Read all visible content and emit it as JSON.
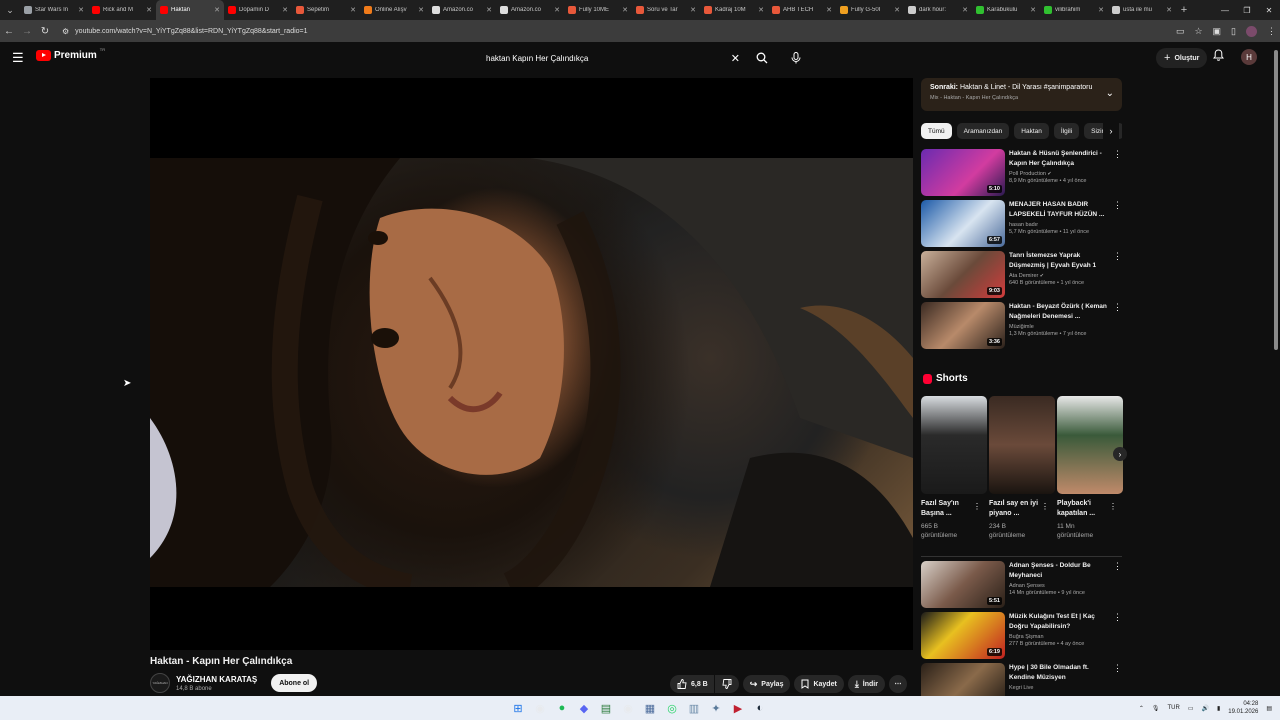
{
  "browser": {
    "tabs": [
      {
        "title": "Star Wars İn",
        "color": "#9aa0a6",
        "active": false
      },
      {
        "title": "Rick and M",
        "color": "#ff0000",
        "active": false
      },
      {
        "title": "Haktan",
        "color": "#ff0000",
        "active": true
      },
      {
        "title": "Dopamin D",
        "color": "#ff0000",
        "active": false
      },
      {
        "title": "Sepetim",
        "color": "#e8583a",
        "active": false
      },
      {
        "title": "Online Alışv",
        "color": "#f07b1a",
        "active": false
      },
      {
        "title": "Amazon.co",
        "color": "#dddddd",
        "active": false
      },
      {
        "title": "Amazon.co",
        "color": "#dddddd",
        "active": false
      },
      {
        "title": "Fully 10ME",
        "color": "#e8583a",
        "active": false
      },
      {
        "title": "Soru ve Tar",
        "color": "#e8583a",
        "active": false
      },
      {
        "title": "Kadraj 10M",
        "color": "#e8583a",
        "active": false
      },
      {
        "title": "AHB TECH",
        "color": "#e8583a",
        "active": false
      },
      {
        "title": "Fully G-50I",
        "color": "#f0a020",
        "active": false
      },
      {
        "title": "dark hour:",
        "color": "#cccccc",
        "active": false
      },
      {
        "title": "Karabukulu",
        "color": "#30c030",
        "active": false
      },
      {
        "title": "vilibrahim",
        "color": "#30c030",
        "active": false
      },
      {
        "title": "usta ile mu",
        "color": "#cccccc",
        "active": false
      }
    ],
    "url": "youtube.com/watch?v=N_YiYTgZq88&list=RDN_YiYTgZq88&start_radio=1"
  },
  "header": {
    "logo_text": "Premium",
    "region": "TR",
    "search_query": "haktan Kapın Her Çalındıkça",
    "create_label": "Oluştur",
    "avatar_letter": "H"
  },
  "video": {
    "title": "Haktan - Kapın Her Çalındıkça",
    "channel": "YAĞIZHAN KARATAŞ",
    "channel_avatar_text": "YAĞIZHAN",
    "subscribers": "14,8 B abone",
    "subscribe_label": "Abone ol",
    "likes": "6,8 B",
    "share_label": "Paylaş",
    "save_label": "Kaydet",
    "download_label": "İndir"
  },
  "up_next": {
    "label": "Sonraki:",
    "title": "Haktan & Linet - Dil Yarası #şanimparatoru",
    "subtitle": "Mix - Haktan - Kapın Her Çalındıkça"
  },
  "chips": [
    "Tümü",
    "Aramanızdan",
    "Haktan",
    "İlgili",
    "Sizin için"
  ],
  "related": [
    {
      "title": "Haktan & Hüsnü Şenlendirici - Kapın Her Çalındıkça",
      "channel": "Poll Production",
      "verified": true,
      "meta": "8,9 Mn görüntüleme • 4 yıl önce",
      "duration": "5:10"
    },
    {
      "title": "MENAJER HASAN BADIR LAPSEKELİ TAYFUR HÜZÜN ...",
      "channel": "hasan badır",
      "verified": false,
      "meta": "5,7 Mn görüntüleme • 11 yıl önce",
      "duration": "6:57"
    },
    {
      "title": "Tanrı İstemezse Yaprak Düşmezmiş | Eyvah Eyvah 1",
      "channel": "Ata Demirer",
      "verified": true,
      "meta": "640 B görüntüleme • 1 yıl önce",
      "duration": "9:03"
    },
    {
      "title": "Haktan - Beyazıt Özürk ( Keman Nağmeleri Denemesi ...",
      "channel": "Müziğimle",
      "verified": false,
      "meta": "1,3 Mn görüntüleme • 7 yıl önce",
      "duration": "3:36"
    }
  ],
  "shorts": {
    "heading": "Shorts",
    "items": [
      {
        "title": "Fazıl Say'ın Başına ...",
        "views": "665 B görüntüleme"
      },
      {
        "title": "Fazıl say en iyi piyano ...",
        "views": "234 B görüntüleme"
      },
      {
        "title": "Playback'i kapatılan ...",
        "views": "11 Mn görüntüleme"
      }
    ]
  },
  "related2": [
    {
      "title": "Adnan Şenses - Doldur Be Meyhaneci",
      "channel": "Adnan Şenses",
      "verified": false,
      "meta": "14 Mn görüntüleme • 9 yıl önce",
      "duration": "5:51"
    },
    {
      "title": "Müzik Kulağını Test Et | Kaç Doğru Yapabilirsin?",
      "channel": "Buğra Şişman",
      "verified": false,
      "meta": "277 B görüntüleme • 4 ay önce",
      "duration": "6:19"
    },
    {
      "title": "Hype | 30 Bile Olmadan ft. Kendine Müzisyen",
      "channel": "Kegri Live",
      "verified": false,
      "meta": "",
      "duration": ""
    }
  ],
  "taskbar": {
    "lang": "TUR",
    "time": "04:28",
    "date": "19.01.2026"
  }
}
